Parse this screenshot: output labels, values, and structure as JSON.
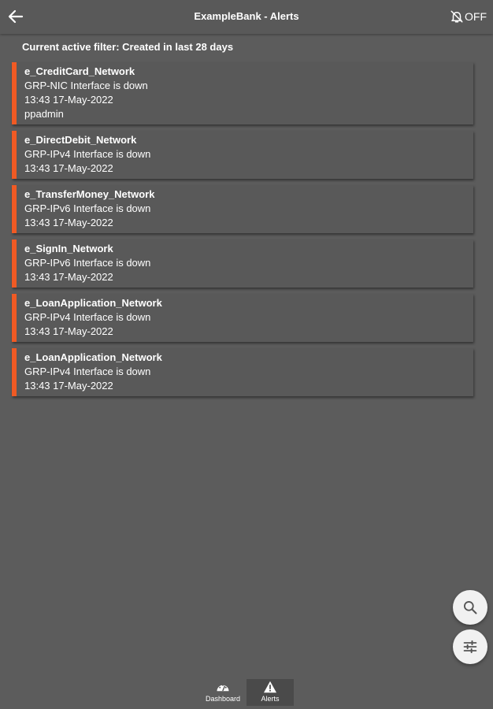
{
  "header": {
    "title": "ExampleBank - Alerts",
    "notifications_label": "OFF"
  },
  "filter": {
    "text": "Current active filter: Created in last 28 days"
  },
  "alerts": [
    {
      "name": "e_CreditCard_Network",
      "message": "GRP-NIC Interface is down",
      "time": "13:43 17-May-2022",
      "user": "ppadmin"
    },
    {
      "name": "e_DirectDebit_Network",
      "message": "GRP-IPv4 Interface is down",
      "time": "13:43 17-May-2022"
    },
    {
      "name": "e_TransferMoney_Network",
      "message": "GRP-IPv6 Interface is down",
      "time": "13:43 17-May-2022"
    },
    {
      "name": "e_SignIn_Network",
      "message": "GRP-IPv6 Interface is down",
      "time": "13:43 17-May-2022"
    },
    {
      "name": "e_LoanApplication_Network",
      "message": "GRP-IPv4 Interface is down",
      "time": "13:43 17-May-2022"
    },
    {
      "name": "e_LoanApplication_Network",
      "message": "GRP-IPv4 Interface is down",
      "time": "13:43 17-May-2022"
    }
  ],
  "nav": {
    "dashboard_label": "Dashboard",
    "alerts_label": "Alerts"
  },
  "colors": {
    "background": "#5c5c5c",
    "accent": "#f05a24",
    "card": "#595959"
  },
  "icons": {
    "back": "arrow-left-icon",
    "notifications": "bell-off-icon",
    "search": "search-icon",
    "filter": "sliders-icon",
    "dashboard": "gauge-icon",
    "alerts": "warning-triangle-icon"
  }
}
